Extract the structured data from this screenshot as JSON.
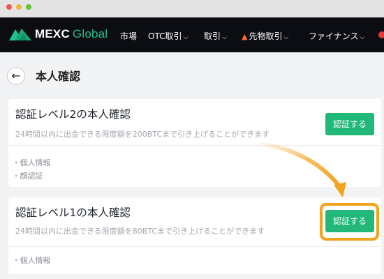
{
  "brand": {
    "name": "MEXC",
    "suffix": "Global"
  },
  "nav": [
    {
      "label": "市場",
      "dropdown": false,
      "fire": false
    },
    {
      "label": "OTC取引",
      "dropdown": true,
      "fire": false
    },
    {
      "label": "取引",
      "dropdown": true,
      "fire": false
    },
    {
      "label": "先物取引",
      "dropdown": true,
      "fire": true
    },
    {
      "label": "ファイナンス",
      "dropdown": true,
      "fire": false
    }
  ],
  "page": {
    "title": "本人確認"
  },
  "level2": {
    "title": "認証レベル2の本人確認",
    "description": "24時間以内に出金できる限度額を200BTCまで引き上げることができます",
    "button": "認証する",
    "requirements": [
      "個人情報",
      "顔認証"
    ]
  },
  "level1": {
    "title": "認証レベル1の本人確認",
    "description": "24時間以内に出金できる限度額を80BTCまで引き上げることができます",
    "button": "認証する",
    "requirements": [
      "個人情報"
    ]
  },
  "colors": {
    "accent": "#22b87a",
    "highlight": "#f3a21c",
    "nav_bg": "#0b0d12",
    "page_bg": "#f2f3f5"
  },
  "icons": {
    "back": "arrow-left-icon",
    "logo": "mexc-logo-icon",
    "fire": "fire-icon",
    "chevron": "chevron-down-icon"
  }
}
